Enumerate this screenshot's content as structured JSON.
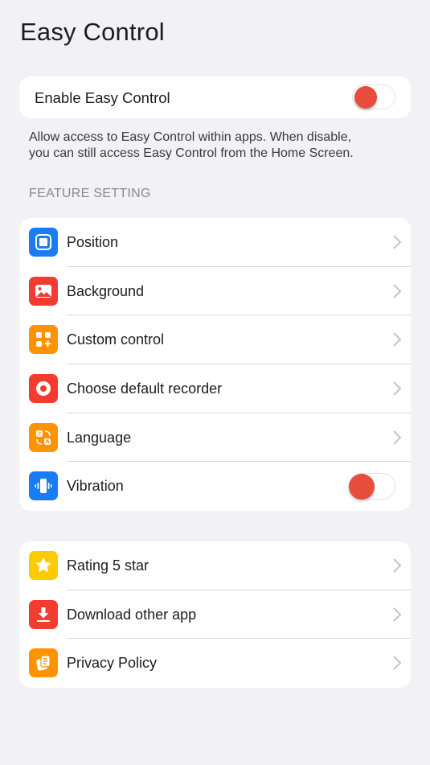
{
  "header": {
    "title": "Easy Control"
  },
  "enable": {
    "label": "Enable Easy Control",
    "toggle_on": false,
    "toggle_color": "#e84c3d"
  },
  "description": {
    "line1": "Allow access to Easy Control within apps. When disable,",
    "line2": "you can still access Easy Control from the Home Screen."
  },
  "feature_section": {
    "header": "FEATURE SETTING",
    "items": [
      {
        "label": "Position",
        "icon": "position-icon",
        "color": "#1a7cf5",
        "control": "chevron"
      },
      {
        "label": "Background",
        "icon": "image-icon",
        "color": "#f33b30",
        "control": "chevron"
      },
      {
        "label": "Custom control",
        "icon": "custom-grid-icon",
        "color": "#fd9300",
        "control": "chevron"
      },
      {
        "label": "Choose default recorder",
        "icon": "record-icon",
        "color": "#f33b30",
        "control": "chevron"
      },
      {
        "label": "Language",
        "icon": "translate-icon",
        "color": "#fd9300",
        "control": "chevron"
      },
      {
        "label": "Vibration",
        "icon": "vibration-icon",
        "color": "#1a7cf5",
        "control": "toggle",
        "toggle_on": false
      }
    ]
  },
  "more_section": {
    "items": [
      {
        "label": "Rating 5 star",
        "icon": "star-icon",
        "color": "#fdcb00",
        "control": "chevron"
      },
      {
        "label": "Download other app",
        "icon": "download-icon",
        "color": "#f33b30",
        "control": "chevron"
      },
      {
        "label": "Privacy Policy",
        "icon": "document-icon",
        "color": "#fd9300",
        "control": "chevron"
      }
    ]
  }
}
